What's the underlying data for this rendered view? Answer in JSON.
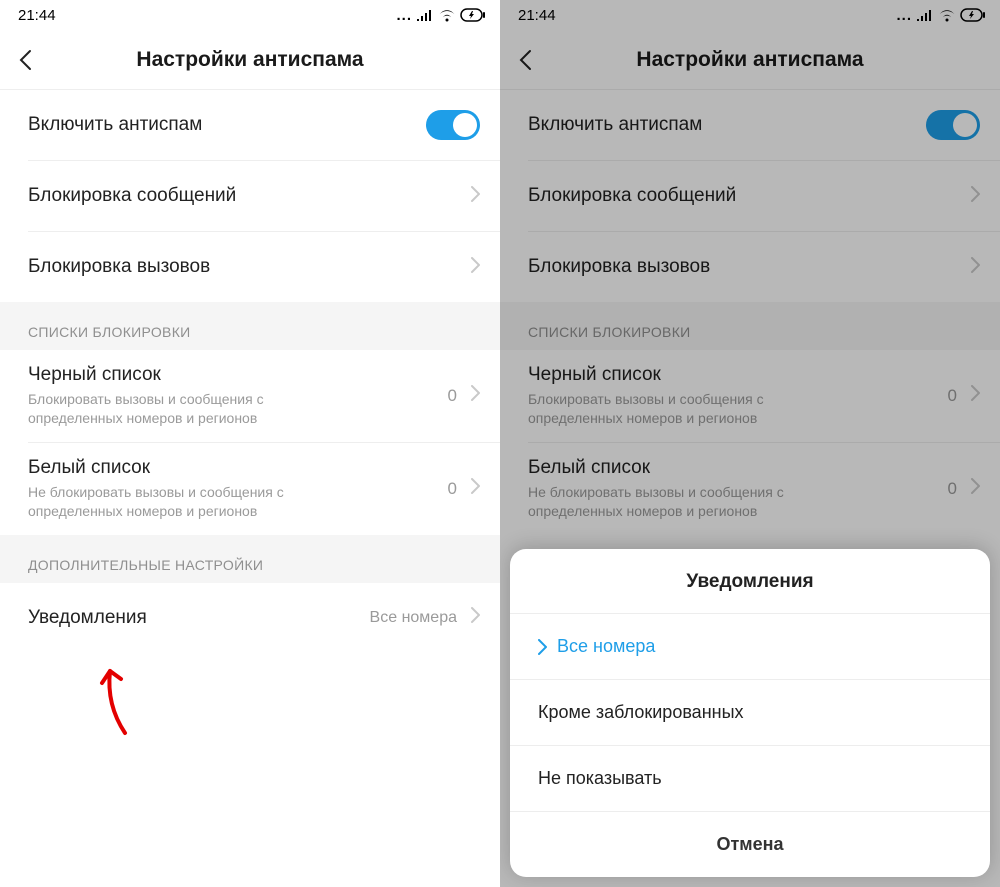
{
  "left": {
    "status": {
      "time": "21:44"
    },
    "header": {
      "title": "Настройки антиспама"
    },
    "toggle": {
      "label": "Включить антиспам"
    },
    "nav": {
      "blockMessages": "Блокировка сообщений",
      "blockCalls": "Блокировка вызовов"
    },
    "section1": {
      "title": "СПИСКИ БЛОКИРОВКИ",
      "black": {
        "title": "Черный список",
        "sub": "Блокировать вызовы и сообщения с определенных номеров и регионов",
        "count": "0"
      },
      "white": {
        "title": "Белый список",
        "sub": "Не блокировать вызовы и сообщения с определенных номеров и регионов",
        "count": "0"
      }
    },
    "section2": {
      "title": "ДОПОЛНИТЕЛЬНЫЕ НАСТРОЙКИ",
      "notifications": {
        "title": "Уведомления",
        "value": "Все номера"
      }
    }
  },
  "right": {
    "status": {
      "time": "21:44"
    },
    "header": {
      "title": "Настройки антиспама"
    },
    "toggle": {
      "label": "Включить антиспам"
    },
    "nav": {
      "blockMessages": "Блокировка сообщений",
      "blockCalls": "Блокировка вызовов"
    },
    "section1": {
      "title": "СПИСКИ БЛОКИРОВКИ",
      "black": {
        "title": "Черный список",
        "sub": "Блокировать вызовы и сообщения с определенных номеров и регионов",
        "count": "0"
      },
      "white": {
        "title": "Белый список",
        "sub": "Не блокировать вызовы и сообщения с определенных номеров и регионов",
        "count": "0"
      }
    },
    "sheet": {
      "title": "Уведомления",
      "opt1": "Все номера",
      "opt2": "Кроме заблокированных",
      "opt3": "Не показывать",
      "cancel": "Отмена"
    }
  }
}
